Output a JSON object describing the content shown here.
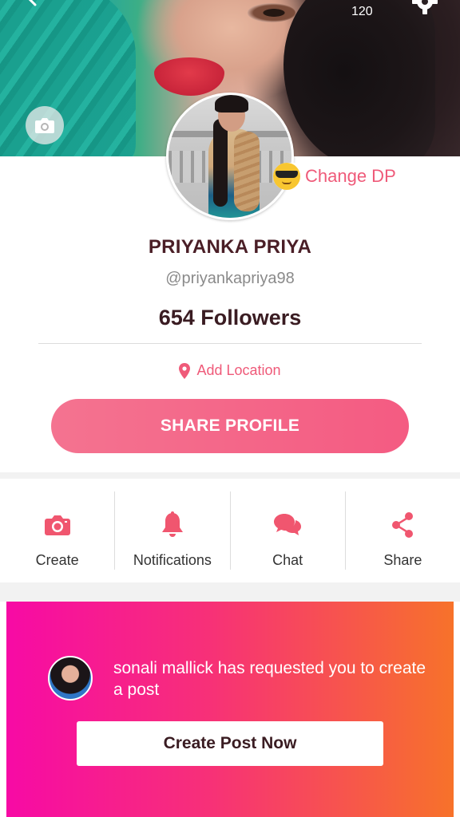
{
  "header": {
    "count": "120",
    "icons": {
      "back": "back-arrow-icon",
      "settings": "gear-icon",
      "cover_camera": "camera-icon"
    }
  },
  "profile": {
    "change_dp_label": "Change DP",
    "change_dp_emoji": "sunglasses-emoji-icon",
    "name": "PRIYANKA PRIYA",
    "handle": "@priyankapriya98",
    "followers": "654 Followers",
    "location_label": "Add Location",
    "share_profile_label": "SHARE PROFILE"
  },
  "actions": [
    {
      "label": "Create",
      "icon": "camera-icon"
    },
    {
      "label": "Notifications",
      "icon": "bell-icon"
    },
    {
      "label": "Chat",
      "icon": "chat-bubbles-icon"
    },
    {
      "label": "Share",
      "icon": "share-icon"
    }
  ],
  "promo": {
    "message": "sonali mallick has requested you to create a post",
    "cta_label": "Create Post Now"
  },
  "colors": {
    "accent": "#ef5a79",
    "share_button": "#f4668a",
    "name_text": "#4a1e26",
    "promo_gradient_start": "#f70aa5",
    "promo_gradient_end": "#f7722a"
  }
}
